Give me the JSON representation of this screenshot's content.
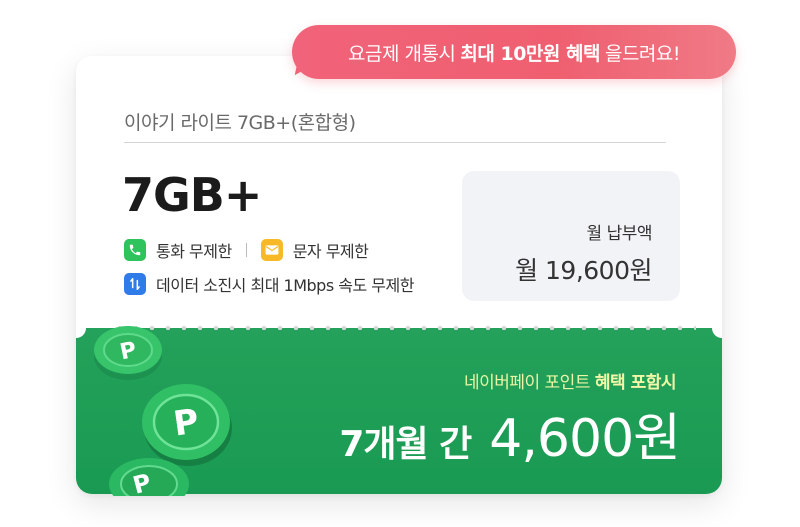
{
  "banner": {
    "text_prefix": "요금제 개통시",
    "text_bold": "최대 10만원 혜택",
    "text_suffix": "을드려요!",
    "color": "#f1637a"
  },
  "plan": {
    "name": "이야기 라이트 7GB+(혼합형)",
    "data_amount": "7GB+",
    "benefits": [
      {
        "icon": "phone-icon",
        "label": "통화 무제한",
        "color": "#2ec35c"
      },
      {
        "icon": "message-icon",
        "label": "문자 무제한",
        "color": "#f7b928"
      },
      {
        "icon": "data-icon",
        "label": "데이터 소진시 최대 1Mbps 속도 무제한",
        "color": "#2f7be8"
      }
    ]
  },
  "fee": {
    "label": "월 납부액",
    "value": "월 19,600원"
  },
  "promo": {
    "label_prefix": "네이버페이 포인트",
    "label_bold": "혜택 포함시",
    "period": "7개월 간",
    "amount": "4,600원",
    "background_color": "#1f9e56"
  },
  "decoration": {
    "coin_icon": "point-coin-icon",
    "coin_letter": "P"
  }
}
